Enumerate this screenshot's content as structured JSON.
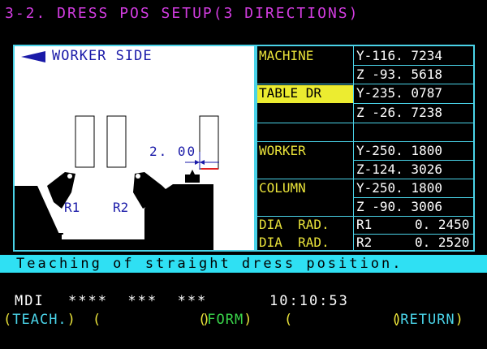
{
  "title": "3-2. DRESS POS SETUP(3 DIRECTIONS)",
  "diagram": {
    "direction_label": "WORKER SIDE",
    "dimension": "2. 00",
    "r1": "R1",
    "r2": "R2"
  },
  "rows": [
    {
      "label": "MACHINE",
      "y": "Y-116. 7234",
      "z": "Z  -93. 5618",
      "highlight": false
    },
    {
      "label": "TABLE DR",
      "y": "Y-235. 0787",
      "z": "Z  -26. 7238",
      "highlight": true
    },
    {
      "label": "WORKER",
      "y": "Y-250. 1800",
      "z": "Z-124. 3026",
      "highlight": false
    },
    {
      "label": "COLUMN",
      "y": "Y-250. 1800",
      "z": "Z  -90. 3006",
      "highlight": false
    }
  ],
  "dia": [
    {
      "label": "DIA  RAD.",
      "key": "R1",
      "value": "0. 2450"
    },
    {
      "label": "DIA  RAD.",
      "key": "R2",
      "value": "0. 2520"
    }
  ],
  "message": "Teaching of straight dress position.",
  "status": {
    "mode": "MDI",
    "fields": "****  ***  ***",
    "time": "10:10:53"
  },
  "softkeys": [
    "TEACH.",
    "",
    "FORM",
    "",
    "RETURN"
  ],
  "colors": {
    "title": "#d23ce0",
    "label": "#e9e23a",
    "border": "#4ad3e8",
    "message_bar": "#2fe0f3",
    "highlight": "#ecec30",
    "drawing": "#1a1aa8"
  }
}
